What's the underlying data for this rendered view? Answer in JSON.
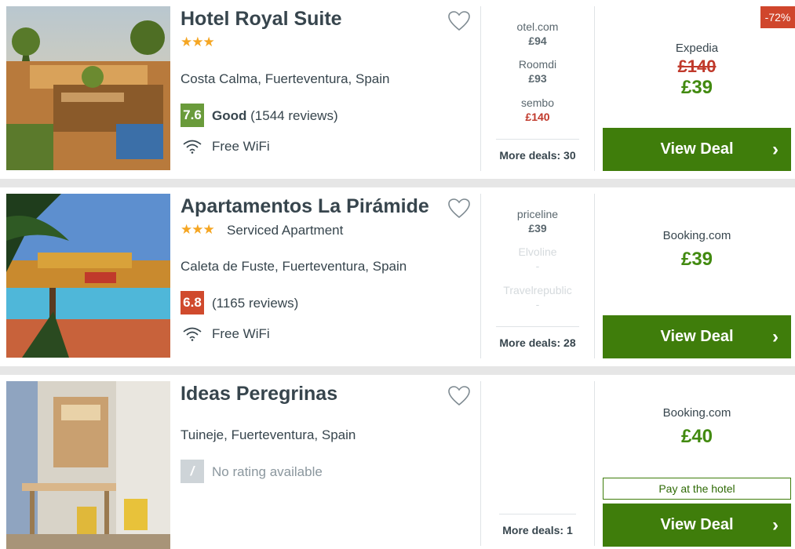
{
  "hotels": [
    {
      "name": "Hotel Royal Suite",
      "stars": "★★★",
      "location": "Costa Calma, Fuerteventura, Spain",
      "rating_score": "7.6",
      "rating_word": "Good",
      "rating_reviews": "(1544 reviews)",
      "amenity": "Free WiFi",
      "deals": [
        {
          "provider": "otel.com",
          "price": "£94"
        },
        {
          "provider": "Roomdi",
          "price": "£93"
        },
        {
          "provider": "sembo",
          "price": "£140"
        }
      ],
      "more_deals": "More deals: 30",
      "main_provider": "Expedia",
      "old_price": "£140",
      "price": "£39",
      "discount": "-72%",
      "button_label": "View Deal",
      "button_chevron": "›"
    },
    {
      "name": "Apartamentos La Pirámide",
      "stars": "★★★",
      "stars_type": "Serviced Apartment",
      "location": "Caleta de Fuste, Fuerteventura, Spain",
      "rating_score": "6.8",
      "rating_reviews": "(1165 reviews)",
      "amenity": "Free WiFi",
      "deals": [
        {
          "provider": "priceline",
          "price": "£39"
        },
        {
          "provider": "Elvoline",
          "price": "-"
        },
        {
          "provider": "Travelrepublic",
          "price": "-"
        }
      ],
      "more_deals": "More deals: 28",
      "main_provider": "Booking.com",
      "price": "£39",
      "button_label": "View Deal",
      "button_chevron": "›"
    },
    {
      "name": "Ideas Peregrinas",
      "location": "Tuineje, Fuerteventura, Spain",
      "rating_score": "/",
      "rating_text": "No rating available",
      "more_deals": "More deals: 1",
      "main_provider": "Booking.com",
      "price": "£40",
      "pay_at_hotel": "Pay at the hotel",
      "button_label": "View Deal",
      "button_chevron": "›"
    }
  ],
  "colors": {
    "rating_good": "#6a9b3b",
    "rating_poor": "#d04a2d",
    "button": "#3f7d0b",
    "price": "#428a10",
    "stars": "#f5a623"
  }
}
